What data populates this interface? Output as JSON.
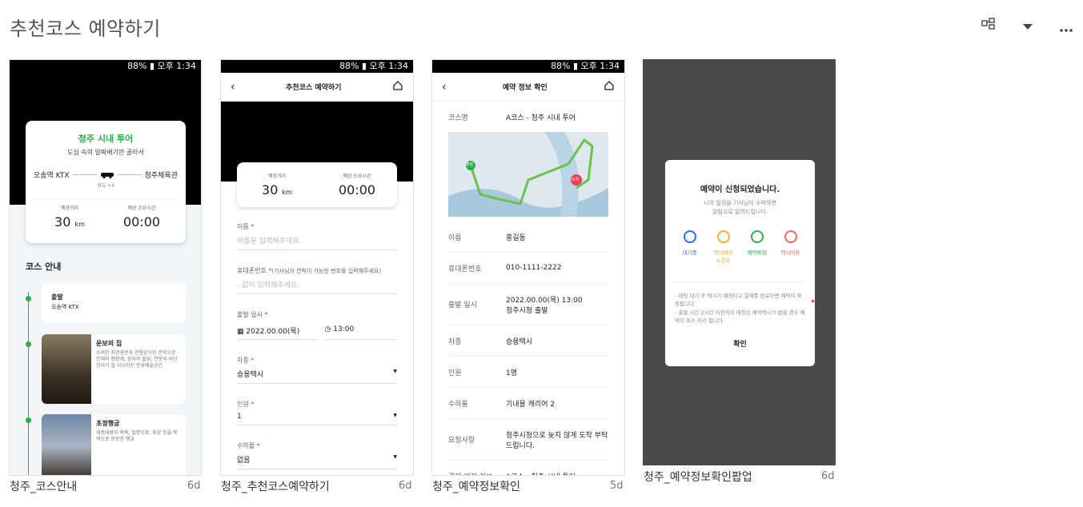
{
  "page": {
    "title": "추천코스 예약하기"
  },
  "header_icons": [
    "node-view-icon",
    "dropdown-caret-icon",
    "more-dots-icon"
  ],
  "status_bar": {
    "text": "88% ▮ 오후 1:34",
    "signal": "signal-icon"
  },
  "cards": [
    {
      "caption": "청주_코스안내",
      "age": "6d"
    },
    {
      "caption": "청주_추천코스예약하기",
      "age": "6d"
    },
    {
      "caption": "청주_예약정보확인",
      "age": "5d"
    },
    {
      "caption": "청주_예약정보확인팝업",
      "age": "6d"
    }
  ],
  "s1": {
    "course_title": "청주 시내 투어",
    "subtitle": "도심 속의 알짜배기만 골라서",
    "from": "오송역 KTX",
    "to": "청주체육관",
    "via": "경유 +4",
    "dist_label": "예상거리",
    "dist_val": "30",
    "dist_unit": "km",
    "time_label": "예상 소요시간",
    "time_val": "00:00",
    "guide_title": "코스 안내",
    "stops": [
      {
        "name": "출발",
        "desc": "오송역 KTX"
      },
      {
        "name": "운보의 집",
        "desc": "수려한 자연경관과 전통양식인 한옥으로 안채와 행랑채, 정자와 돌담, 연못의 비단잉어가 잘 어우러진 문화예술공간"
      },
      {
        "name": "초정행궁",
        "desc": "세종대왕이 목욕, 질병치료, 휴양 등을 목적으로 방문한 행궁"
      }
    ]
  },
  "s2": {
    "nav_title": "추천코스 예약하기",
    "dist_label": "예상거리",
    "dist_val": "30",
    "dist_unit": "km",
    "time_label": "예상 소요시간",
    "time_val": "00:00",
    "name_label": "이름",
    "name_ph": "이름을 입력해주세요.",
    "phone_label": "휴대폰번호",
    "phone_note": "(기사님과 연락이 가능한 번호를 입력해주세요)",
    "phone_ph": "- 없이 입력해주세요.",
    "date_label": "출발 일시",
    "date_val": "2022.00.00(목)",
    "time_val2": "13:00",
    "car_label": "차종",
    "car_val": "승용택시",
    "ppl_label": "인원",
    "ppl_val": "1",
    "bag_label": "수하물",
    "bag_val": "없음"
  },
  "s3": {
    "nav_title": "예약 정보 확인",
    "course_label": "코스명",
    "course_val": "A코스 - 청주 시내 투어",
    "map_start": "출발",
    "map_end": "도착",
    "rows": [
      {
        "k": "이름",
        "v": "홍길동"
      },
      {
        "k": "휴대폰번호",
        "v": "010-1111-2222"
      },
      {
        "k": "출발 일시",
        "v": "2022.00.00(목) 13:00\n청주시청 출발"
      },
      {
        "k": "차종",
        "v": "승용택시"
      },
      {
        "k": "인원",
        "v": "1명"
      },
      {
        "k": "수하물",
        "v": "기내용 캐리어 2"
      },
      {
        "k": "요청사항",
        "v": "청주시청으로 늦지 않게 도착 부탁드립니다."
      },
      {
        "k": "결제 예정 정보",
        "v": "A코스 - 청주 시내 투어"
      }
    ]
  },
  "s4": {
    "title": "예약이 신청되었습니다.",
    "desc": "나의 일정을 기사님이 수락하면\n알림으로 알려드립니다.",
    "steps": [
      {
        "label": "대기중",
        "color": "#2b6ff0"
      },
      {
        "label": "택시배정\n&결제",
        "color": "#f0b323"
      },
      {
        "label": "예약확정",
        "color": "#27b04a"
      },
      {
        "label": "택시이용",
        "color": "#f06a5a"
      }
    ],
    "notes": "- 매칭 대기 후 택시가 배정되고 결제를 완료하면 예약이 확정됩니다.\n- 출발 시간 2시간 이전까지 매칭된 예약택시가 없을 경우 예약이 취소 처리 됩니다.",
    "confirm": "확인"
  }
}
